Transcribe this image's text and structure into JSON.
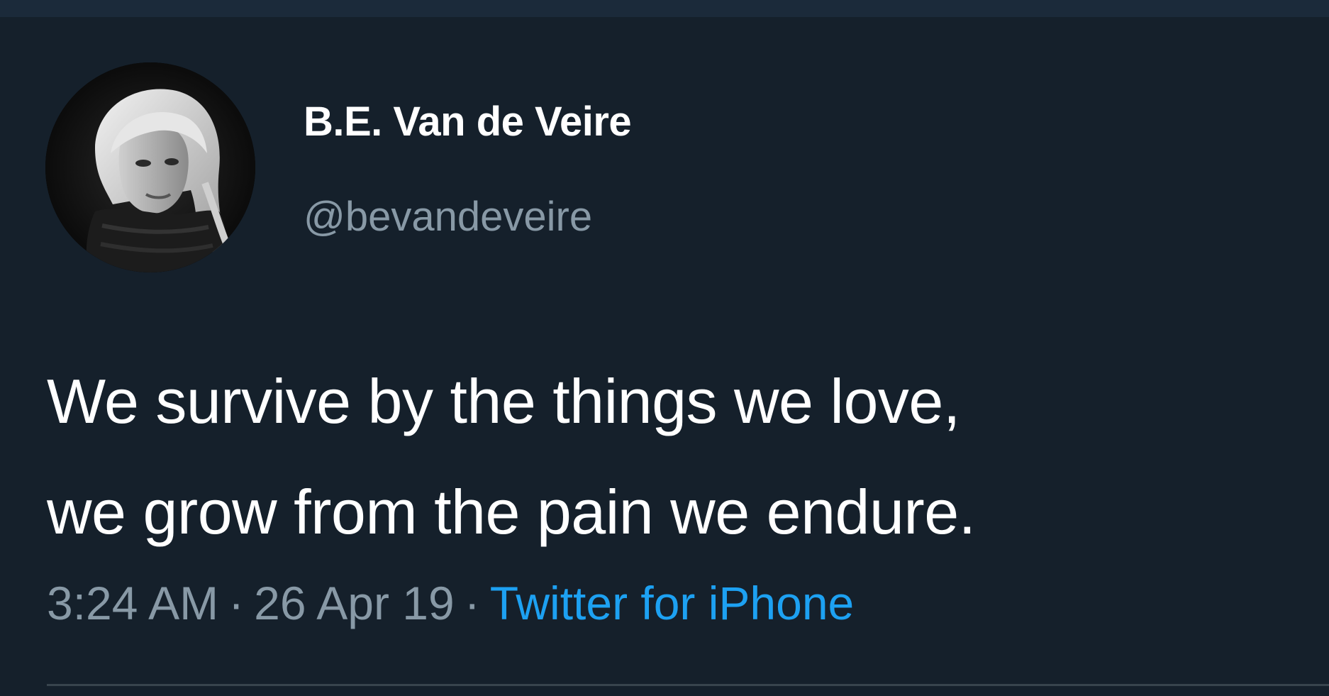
{
  "tweet": {
    "author": {
      "display_name": "B.E. Van de Veire",
      "handle": "@bevandeveire",
      "avatar_icon": "profile-photo"
    },
    "text_lines": [
      "We survive by the things we love,",
      "we grow from the pain we endure."
    ],
    "meta": {
      "time": "3:24 AM",
      "separator": "·",
      "date": "26 Apr 19",
      "source": "Twitter for iPhone"
    }
  },
  "colors": {
    "background": "#15202b",
    "primary_text": "#ffffff",
    "secondary_text": "#8899a6",
    "link": "#1da1f2",
    "divider": "#38444d"
  }
}
